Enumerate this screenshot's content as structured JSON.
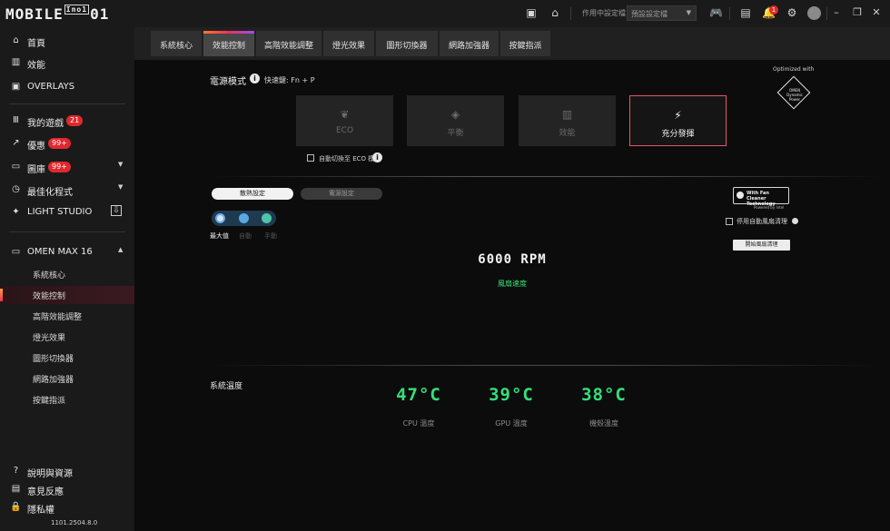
{
  "app": {
    "logo_text": "MOBILE",
    "logo_small": "Ino1",
    "logo_tail": "01"
  },
  "topbar": {
    "profile_label": "作用中設定檔",
    "profile_value": "預設設定檔",
    "notification_count": "1"
  },
  "sidebar": {
    "items": [
      {
        "label": "首頁",
        "icon": "home-icon"
      },
      {
        "label": "效能",
        "icon": "performance-icon"
      },
      {
        "label": "OVERLAYS",
        "icon": "overlay-icon"
      },
      {
        "label": "我的遊戲",
        "icon": "library-icon",
        "badge": "21"
      },
      {
        "label": "優惠",
        "icon": "trending-icon",
        "badge": "99+"
      },
      {
        "label": "圖庫",
        "icon": "gallery-icon",
        "badge": "99+"
      },
      {
        "label": "最佳化程式",
        "icon": "optimizer-icon"
      },
      {
        "label": "LIGHT STUDIO",
        "icon": "sparkle-icon"
      }
    ],
    "device": {
      "label": "OMEN MAX 16",
      "icon": "laptop-icon"
    },
    "sub_items": [
      "系統核心",
      "效能控制",
      "高階效能調整",
      "燈光效果",
      "圖形切換器",
      "網路加強器",
      "按鍵指派"
    ],
    "footer": [
      {
        "label": "說明與資源",
        "icon": "help-icon"
      },
      {
        "label": "意見反應",
        "icon": "feedback-icon"
      },
      {
        "label": "隱私權",
        "icon": "lock-icon"
      }
    ],
    "version": "1101.2504.8.0"
  },
  "tabs": [
    "系統核心",
    "效能控制",
    "高階效能調整",
    "燈光效果",
    "圖形切換器",
    "網路加強器",
    "按鍵指派"
  ],
  "power": {
    "title": "電源模式",
    "shortcut": "快速鍵: Fn + P",
    "modes": [
      {
        "label": "ECO",
        "icon": "leaf-icon"
      },
      {
        "label": "平衡",
        "icon": "balance-icon"
      },
      {
        "label": "效能",
        "icon": "bars-icon"
      },
      {
        "label": "充分發揮",
        "icon": "unleashed-icon"
      }
    ],
    "eco_auto_label": "自動切換至 ECO 模式",
    "optimized_with": "Optimized with",
    "omen_logo_text": "OMEN Dynamic Power"
  },
  "fan": {
    "tab_thermal": "散熱設定",
    "tab_power": "電源設定",
    "mode_max": "最大值",
    "mode_auto": "自動",
    "mode_manual": "手動",
    "rpm": "6000 RPM",
    "rpm_label": "風扇速度",
    "cleaner_line1": "With Fan Cleaner",
    "cleaner_line2": "Technology",
    "cleaner_intel": "Powered by Intel",
    "cleaner_auto_label": "停用自動風扇清理",
    "cleaner_button": "開始風扇清理"
  },
  "temps": {
    "title": "系統溫度",
    "items": [
      {
        "value": "47°C",
        "label": "CPU 溫度"
      },
      {
        "value": "39°C",
        "label": "GPU 溫度"
      },
      {
        "value": "38°C",
        "label": "機殼溫度"
      }
    ]
  },
  "colors": {
    "accent_green": "#33e07a",
    "badge_red": "#e0292f",
    "active_border": "#e8546a"
  }
}
